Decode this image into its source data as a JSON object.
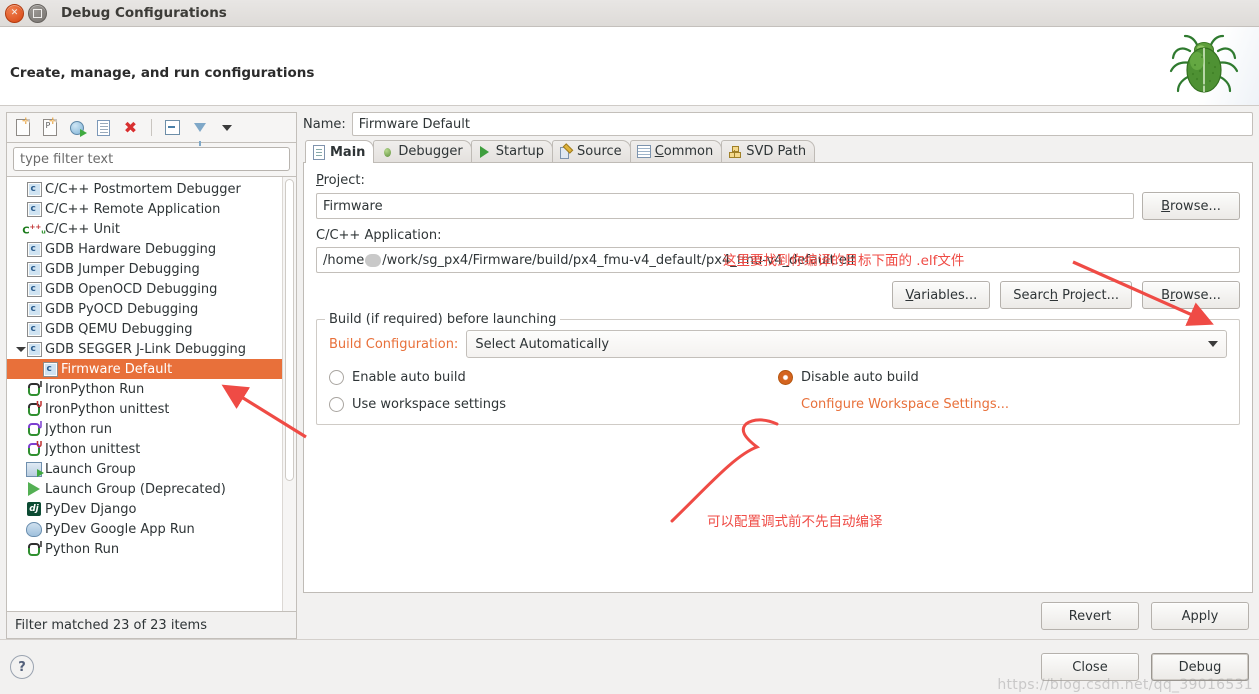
{
  "window": {
    "title": "Debug Configurations",
    "close_icon": "close-icon",
    "maximize_icon": "maximize-icon"
  },
  "header": {
    "title": "Create, manage, and run configurations",
    "decoration_icon": "bug-icon"
  },
  "left_panel": {
    "toolbar": [
      {
        "name": "new-configuration-icon",
        "label": "New launch configuration"
      },
      {
        "name": "new-prototype-icon",
        "label": "New prototype"
      },
      {
        "name": "export-icon",
        "label": "Export"
      },
      {
        "name": "duplicate-icon",
        "label": "Duplicate"
      },
      {
        "name": "delete-icon",
        "label": "Delete"
      },
      {
        "name": "collapse-all-icon",
        "label": "Collapse All"
      },
      {
        "name": "filter-icon",
        "label": "Filter"
      },
      {
        "name": "view-menu-icon",
        "label": "View Menu"
      }
    ],
    "filter": {
      "placeholder": "type filter text",
      "value": ""
    },
    "tree": [
      {
        "label": "C/C++ Postmortem Debugger",
        "icon": "c-launch-icon",
        "indent": 0,
        "twisty": "none",
        "selected": false
      },
      {
        "label": "C/C++ Remote Application",
        "icon": "c-launch-icon",
        "indent": 0,
        "twisty": "none",
        "selected": false
      },
      {
        "label": "C/C++ Unit",
        "icon": "cpp-unit-icon",
        "indent": 0,
        "twisty": "none",
        "selected": false
      },
      {
        "label": "GDB Hardware Debugging",
        "icon": "c-launch-icon",
        "indent": 0,
        "twisty": "none",
        "selected": false
      },
      {
        "label": "GDB Jumper Debugging",
        "icon": "c-launch-icon",
        "indent": 0,
        "twisty": "none",
        "selected": false
      },
      {
        "label": "GDB OpenOCD Debugging",
        "icon": "c-launch-icon",
        "indent": 0,
        "twisty": "none",
        "selected": false
      },
      {
        "label": "GDB PyOCD Debugging",
        "icon": "c-launch-icon",
        "indent": 0,
        "twisty": "none",
        "selected": false
      },
      {
        "label": "GDB QEMU Debugging",
        "icon": "c-launch-icon",
        "indent": 0,
        "twisty": "none",
        "selected": false
      },
      {
        "label": "GDB SEGGER J-Link Debugging",
        "icon": "c-launch-icon",
        "indent": 0,
        "twisty": "expanded",
        "selected": false
      },
      {
        "label": "Firmware Default",
        "icon": "c-launch-icon",
        "indent": 1,
        "twisty": "none",
        "selected": true
      },
      {
        "label": "IronPython Run",
        "icon": "python-run-icon",
        "indent": 0,
        "twisty": "none",
        "selected": false
      },
      {
        "label": "IronPython unittest",
        "icon": "python-unittest-icon",
        "indent": 0,
        "twisty": "none",
        "selected": false
      },
      {
        "label": "Jython run",
        "icon": "jython-run-icon",
        "indent": 0,
        "twisty": "none",
        "selected": false
      },
      {
        "label": "Jython unittest",
        "icon": "jython-unittest-icon",
        "indent": 0,
        "twisty": "none",
        "selected": false
      },
      {
        "label": "Launch Group",
        "icon": "launch-group-icon",
        "indent": 0,
        "twisty": "none",
        "selected": false
      },
      {
        "label": "Launch Group (Deprecated)",
        "icon": "play-icon",
        "indent": 0,
        "twisty": "none",
        "selected": false
      },
      {
        "label": "PyDev Django",
        "icon": "django-icon",
        "indent": 0,
        "twisty": "none",
        "selected": false
      },
      {
        "label": "PyDev Google App Run",
        "icon": "google-app-icon",
        "indent": 0,
        "twisty": "none",
        "selected": false
      },
      {
        "label": "Python Run",
        "icon": "python-run-icon",
        "indent": 0,
        "twisty": "none",
        "selected": false
      }
    ],
    "status": "Filter matched 23 of 23 items"
  },
  "right_panel": {
    "name_label": "Name:",
    "name_value": "Firmware Default",
    "tabs": [
      {
        "label": "Main",
        "icon": "document-icon",
        "active": true
      },
      {
        "label": "Debugger",
        "icon": "bug-icon",
        "active": false
      },
      {
        "label": "Startup",
        "icon": "play-icon",
        "active": false
      },
      {
        "label": "Source",
        "icon": "source-edit-icon",
        "active": false
      },
      {
        "label": "Common",
        "icon": "table-icon",
        "active": false
      },
      {
        "label": "SVD Path",
        "icon": "hierarchy-icon",
        "active": false
      }
    ],
    "main_tab": {
      "project_label": "Project:",
      "project_value": "Firmware",
      "project_browse": "Browse...",
      "application_label": "C/C++ Application:",
      "application_value_prefix": "/home",
      "application_value_suffix": "/work/sg_px4/Firmware/build/px4_fmu-v4_default/px4_fmu-v4_default.elf",
      "application_buttons": [
        "Variables...",
        "Search Project...",
        "Browse..."
      ],
      "build_group_legend": "Build (if required) before launching",
      "build_configuration_label": "Build Configuration:",
      "build_configuration_value": "Select Automatically",
      "radios": [
        {
          "label": "Enable auto build",
          "selected": false
        },
        {
          "label": "Disable auto build",
          "selected": true
        },
        {
          "label": "Use workspace settings",
          "selected": false
        }
      ],
      "configure_link": "Configure Workspace Settings..."
    },
    "revert_label": "Revert",
    "apply_label": "Apply"
  },
  "footer": {
    "help_icon": "help-icon",
    "close_label": "Close",
    "debug_label": "Debug",
    "watermark": "https://blog.csdn.net/qq_39016531"
  },
  "annotations": [
    {
      "id": "elf-note",
      "text": "这里要找到你编译的目标下面的 .elf文件",
      "color": "#ef4b45"
    },
    {
      "id": "autobuild-note",
      "text": "可以配置调式前不先自动编译",
      "color": "#ef4b45"
    }
  ],
  "colors": {
    "selection": "#e8703a",
    "accent_orange": "#e8703a",
    "annotation_red": "#ef4b45",
    "window_bg": "#f2f1f0"
  }
}
